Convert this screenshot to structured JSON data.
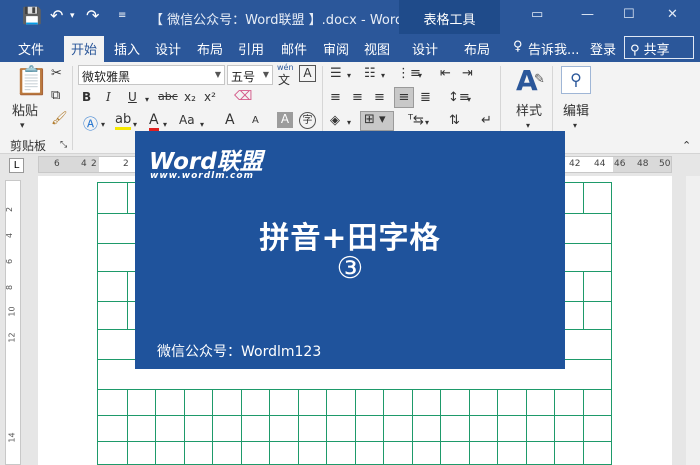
{
  "window": {
    "title": "【 微信公众号：Word联盟 】.docx - Word",
    "context_tools": "表格工具",
    "minimize": "▭",
    "restore": "—",
    "maximize": "☐",
    "close": "✕"
  },
  "quick_access": {
    "save_icon": "save-icon",
    "undo_icon": "undo-icon",
    "redo_icon": "redo-icon",
    "customize_icon": "customize-icon"
  },
  "tabs": [
    "文件",
    "开始",
    "插入",
    "设计",
    "布局",
    "引用",
    "邮件",
    "审阅",
    "视图",
    "设计",
    "布局"
  ],
  "active_tab": "开始",
  "tell_me": "告诉我...",
  "signin": "登录",
  "share": "共享",
  "ribbon": {
    "clipboard": {
      "paste_label": "粘贴",
      "group_label": "剪贴板"
    },
    "font": {
      "font_name": "微软雅黑",
      "font_size": "五号",
      "wen_label": "wén",
      "bold": "B",
      "italic": "I",
      "underline": "U",
      "strike": "abc",
      "subscript": "x₂",
      "superscript": "x²",
      "font_color_label": "A",
      "change_case": "Aa",
      "grow": "A",
      "shrink": "A",
      "clear": "A",
      "char_border": "A",
      "enclose": "字"
    },
    "styles_label": "样式",
    "editing_label": "编辑"
  },
  "ruler": {
    "tab_selector": "L",
    "numbers_left": [
      "6",
      "4",
      "2",
      "2"
    ],
    "numbers_right": [
      "42",
      "44",
      "46",
      "48",
      "50"
    ],
    "vertical_numbers": [
      "2",
      "4",
      "6",
      "8",
      "10",
      "12",
      "14"
    ]
  },
  "overlay": {
    "logo_word": "Word",
    "logo_cn": "联盟",
    "logo_url": "www.wordlm.com",
    "title": "拼音+田字格",
    "number": "③",
    "footer": "微信公众号：Wordlm123"
  },
  "colors": {
    "brand_blue": "#2b579a",
    "overlay_blue": "#1f539c",
    "grid_green": "#1e9a6a"
  }
}
